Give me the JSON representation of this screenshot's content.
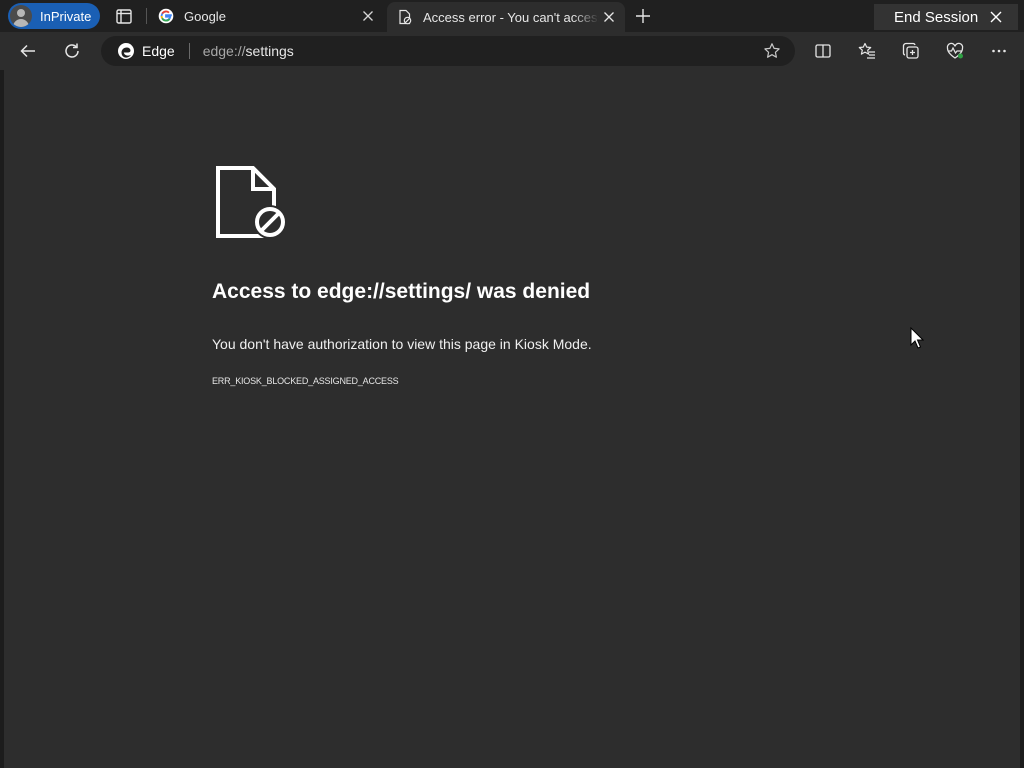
{
  "tabstrip": {
    "inprivate_label": "InPrivate",
    "tabs": [
      {
        "title": "Google",
        "favicon": "google-icon"
      },
      {
        "title": "Access error - You can't access this page",
        "favicon": "blocked-page-icon"
      }
    ],
    "end_session_label": "End Session"
  },
  "toolbar": {
    "site_badge": "Edge",
    "url_scheme": "edge://",
    "url_path": "settings",
    "icons": [
      "back-icon",
      "refresh-icon",
      "star-icon",
      "split-screen-icon",
      "favorites-icon",
      "collections-icon",
      "browser-essentials-icon",
      "more-icon"
    ]
  },
  "error_page": {
    "title": "Access to edge://settings/ was denied",
    "description": "You don't have authorization to view this page in Kiosk Mode.",
    "code": "ERR_KIOSK_BLOCKED_ASSIGNED_ACCESS"
  },
  "colors": {
    "inprivate_blue": "#1a5fb4",
    "page_background": "#2d2d2d",
    "tabstrip_background": "#202020"
  }
}
